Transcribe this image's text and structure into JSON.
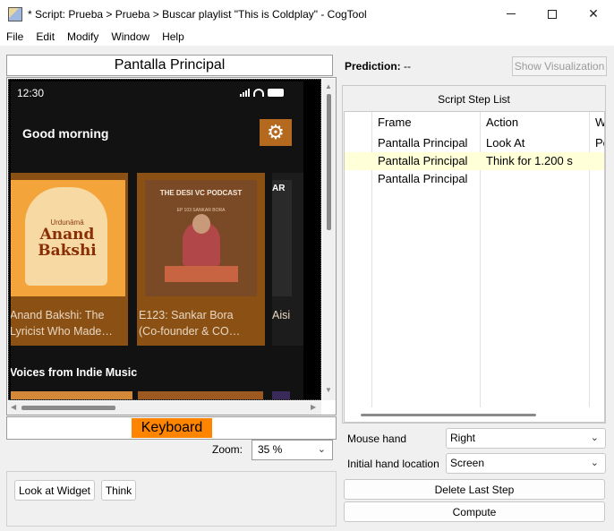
{
  "window": {
    "title": "* Script: Prueba > Prueba > Buscar playlist \"This is Coldplay\" - CogTool",
    "minimize_icon": "minimize-icon",
    "maximize_icon": "maximize-icon",
    "close_icon": "close-icon"
  },
  "menu": [
    "File",
    "Edit",
    "Modify",
    "Window",
    "Help"
  ],
  "frame": {
    "name": "Pantalla Principal"
  },
  "phone": {
    "time": "12:30",
    "greeting": "Good morning",
    "gear_icon": "gear-icon",
    "cards": [
      {
        "art_top": "Urdunāmā",
        "art_title": "Anand Bakshi",
        "label_line1": "Anand Bakshi: The",
        "label_line2": "Lyricist Who Made…"
      },
      {
        "art_title": "THE DESI VC PODCAST",
        "art_sub": "EP 103 SANKAR BORA",
        "label_line1": "E123: Sankar Bora",
        "label_line2": "(Co-founder & CO…"
      },
      {
        "art_title": "AR",
        "label_line1": "Aisi",
        "label_line2": ""
      }
    ],
    "section_title": "Voices from Indie Music"
  },
  "keyboard": {
    "label": "Keyboard"
  },
  "zoom": {
    "label": "Zoom:",
    "value": "35 %"
  },
  "widget_buttons": {
    "look_at": "Look at Widget",
    "think": "Think"
  },
  "prediction": {
    "label": "Prediction:",
    "value": "--"
  },
  "show_visualization": "Show Visualization",
  "script_steps": {
    "title": "Script Step List",
    "columns": [
      "Frame",
      "Action",
      "W"
    ],
    "rows": [
      {
        "frame": "Pantalla Principal",
        "action": "Look At",
        "widget": "Po"
      },
      {
        "frame": "Pantalla Principal",
        "action": "Think for 1.200 s",
        "widget": ""
      },
      {
        "frame": "Pantalla Principal",
        "action": "",
        "widget": ""
      }
    ]
  },
  "mouse_hand": {
    "label": "Mouse hand",
    "value": "Right"
  },
  "initial_hand_location": {
    "label": "Initial hand location",
    "value": "Screen"
  },
  "delete_last_step": "Delete Last Step",
  "compute": "Compute",
  "colors": {
    "keyboard_accent": "#ff8400",
    "row_highlight": "#ffffd8",
    "phone_bg": "#121212",
    "gear_bg": "#b5691f"
  }
}
